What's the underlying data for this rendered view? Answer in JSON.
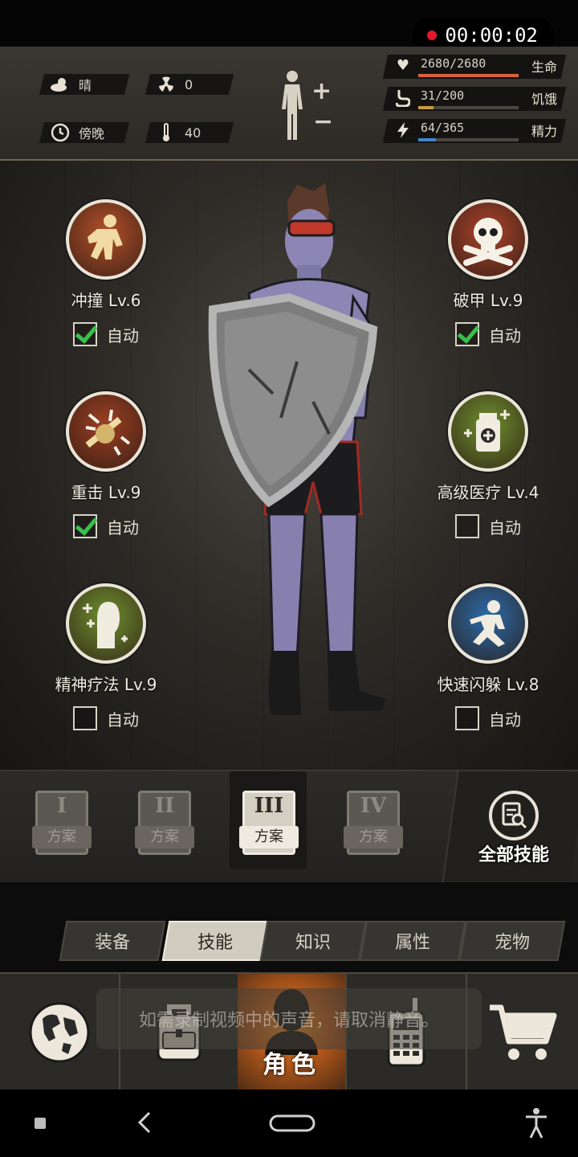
{
  "recorder": {
    "time": "00:00:02"
  },
  "hud": {
    "weather": {
      "label": "晴",
      "icon": "cloud-sun-icon"
    },
    "radiation": {
      "value": "0",
      "icon": "radiation-icon"
    },
    "time_of_day": {
      "label": "傍晚",
      "icon": "clock-icon"
    },
    "temperature": {
      "value": "40",
      "icon": "thermometer-icon"
    },
    "stats": [
      {
        "name": "生命",
        "value": "2680/2680",
        "fill": 1.0,
        "color": "#d9623f",
        "icon": "heart-icon"
      },
      {
        "name": "饥饿",
        "value": "31/200",
        "fill": 0.155,
        "color": "#c99a3a",
        "icon": "stomach-icon"
      },
      {
        "name": "精力",
        "value": "64/365",
        "fill": 0.175,
        "color": "#3f86c8",
        "icon": "energy-icon"
      }
    ]
  },
  "skills": [
    {
      "name": "冲撞 Lv.6",
      "auto_label": "自动",
      "auto": true,
      "icon": "charge-icon",
      "color": "#b3502a"
    },
    {
      "name": "破甲 Lv.9",
      "auto_label": "自动",
      "auto": true,
      "icon": "skull-crossbones-icon",
      "color": "#a9432b"
    },
    {
      "name": "重击 Lv.9",
      "auto_label": "自动",
      "auto": true,
      "icon": "heavy-strike-icon",
      "color": "#9c3f22"
    },
    {
      "name": "高级医疗 Lv.4",
      "auto_label": "自动",
      "auto": false,
      "icon": "medkit-icon",
      "color": "#6f8e2f"
    },
    {
      "name": "精神疗法 Lv.9",
      "auto_label": "自动",
      "auto": false,
      "icon": "mind-heal-icon",
      "color": "#6f8e2f"
    },
    {
      "name": "快速闪躲 Lv.8",
      "auto_label": "自动",
      "auto": false,
      "icon": "dodge-icon",
      "color": "#2b6aa8"
    }
  ],
  "plans": [
    {
      "num": "I",
      "label": "方案",
      "active": false
    },
    {
      "num": "II",
      "label": "方案",
      "active": false
    },
    {
      "num": "III",
      "label": "方案",
      "active": true
    },
    {
      "num": "IV",
      "label": "方案",
      "active": false
    }
  ],
  "all_skills_label": "全部技能",
  "tabs": [
    {
      "label": "装备",
      "active": false
    },
    {
      "label": "技能",
      "active": true
    },
    {
      "label": "知识",
      "active": false
    },
    {
      "label": "属性",
      "active": false
    },
    {
      "label": "宠物",
      "active": false
    }
  ],
  "nav": {
    "items": [
      {
        "icon": "globe-icon"
      },
      {
        "icon": "backpack-icon"
      },
      {
        "icon": "character-icon",
        "label": "角色",
        "active": true
      },
      {
        "icon": "radio-icon"
      },
      {
        "icon": "cart-icon"
      }
    ]
  },
  "toast": "如需录制视频中的声音，请取消静音。"
}
